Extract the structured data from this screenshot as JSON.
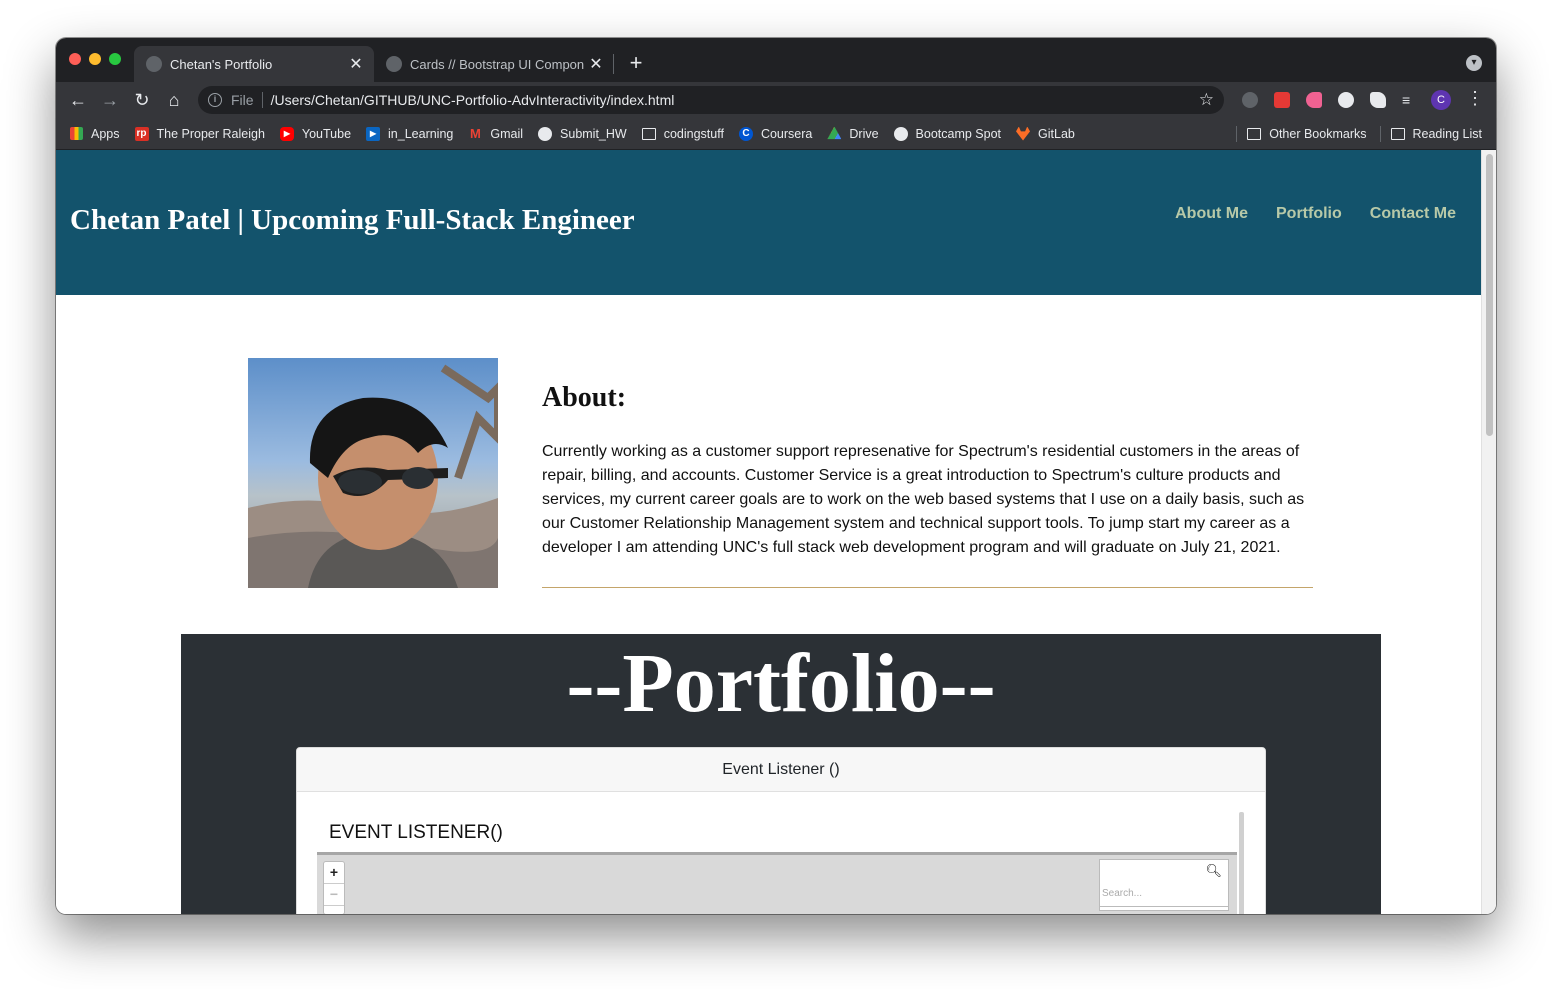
{
  "browser": {
    "tabs": [
      {
        "title": "Chetan's Portfolio",
        "active": true
      },
      {
        "title": "Cards // Bootstrap UI Compone",
        "active": false
      }
    ],
    "close_glyph": "✕",
    "new_tab_glyph": "+",
    "address": {
      "scheme": "File",
      "url": "/Users/Chetan/GITHUB/UNC-Portfolio-AdvInteractivity/index.html"
    },
    "profile_initial": "C",
    "bookmarks": [
      {
        "label": "Apps",
        "icon": "apps-grid-icon",
        "color": "#4285f4"
      },
      {
        "label": "The Proper Raleigh",
        "icon": "proper-raleigh-icon",
        "color": "#d93025",
        "glyph": "rp"
      },
      {
        "label": "YouTube",
        "icon": "youtube-icon",
        "color": "#ff0000",
        "glyph": "▶"
      },
      {
        "label": "in_Learning",
        "icon": "linkedin-learning-icon",
        "color": "#0a66c2",
        "glyph": "▶"
      },
      {
        "label": "Gmail",
        "icon": "gmail-icon",
        "color": "#ea4335",
        "glyph": "M"
      },
      {
        "label": "Submit_HW",
        "icon": "globe-icon",
        "color": "#e8eaed"
      },
      {
        "label": "codingstuff",
        "icon": "folder-icon",
        "color": "#e8eaed"
      },
      {
        "label": "Coursera",
        "icon": "coursera-icon",
        "color": "#0056d2",
        "glyph": "C"
      },
      {
        "label": "Drive",
        "icon": "google-drive-icon",
        "color": "#34a853"
      },
      {
        "label": "Bootcamp Spot",
        "icon": "globe-icon",
        "color": "#e8eaed"
      },
      {
        "label": "GitLab",
        "icon": "gitlab-icon",
        "color": "#fc6d26"
      }
    ],
    "bookmarks_right": [
      {
        "label": "Other Bookmarks",
        "icon": "folder-icon"
      },
      {
        "label": "Reading List",
        "icon": "reading-list-icon"
      }
    ]
  },
  "site": {
    "title": "Chetan Patel | Upcoming Full-Stack Engineer",
    "nav": [
      "About Me",
      "Portfolio",
      "Contact Me"
    ],
    "header_color": "#13536c",
    "nav_color": "#b7c9a8",
    "about": {
      "heading": "About:",
      "text": "Currently working as a customer support represenative for Spectrum's residential customers in the areas of repair, billing, and accounts. Customer Service is a great introduction to Spectrum's culture products and services, my current career goals are to work on the web based systems that I use on a daily basis, such as our Customer Relationship Management system and technical support tools. To jump start my career as a developer I am attending UNC's full stack web development program and will graduate on July 21, 2021."
    },
    "portfolio": {
      "title": "--Portfolio--",
      "card_header": "Event Listener ()",
      "preview_heading": "EVENT LISTENER()",
      "zoom_in": "+",
      "zoom_out": "−",
      "search_placeholder": "Search..."
    }
  }
}
